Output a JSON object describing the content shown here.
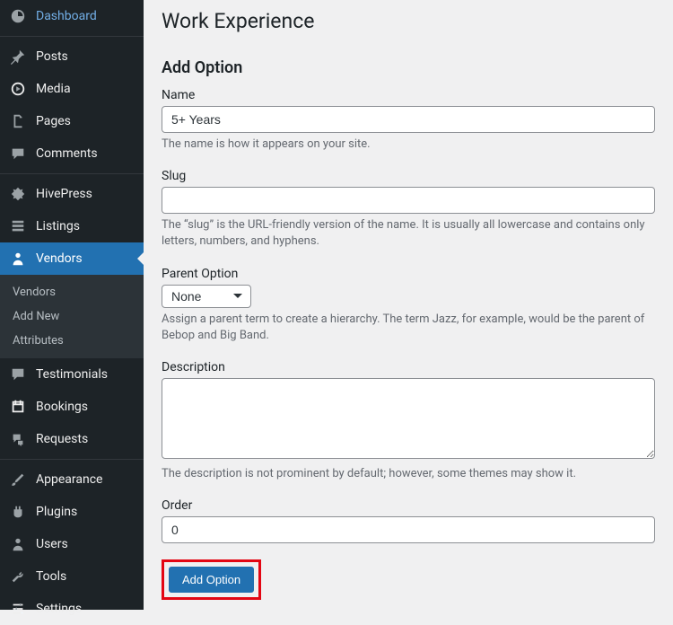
{
  "sidebar": {
    "items": [
      {
        "label": "Dashboard"
      },
      {
        "label": "Posts"
      },
      {
        "label": "Media"
      },
      {
        "label": "Pages"
      },
      {
        "label": "Comments"
      },
      {
        "label": "HivePress"
      },
      {
        "label": "Listings"
      },
      {
        "label": "Vendors"
      },
      {
        "label": "Testimonials"
      },
      {
        "label": "Bookings"
      },
      {
        "label": "Requests"
      },
      {
        "label": "Appearance"
      },
      {
        "label": "Plugins"
      },
      {
        "label": "Users"
      },
      {
        "label": "Tools"
      },
      {
        "label": "Settings"
      }
    ],
    "submenu": [
      {
        "label": "Vendors"
      },
      {
        "label": "Add New"
      },
      {
        "label": "Attributes"
      }
    ]
  },
  "page": {
    "title": "Work Experience",
    "section_title": "Add Option",
    "name": {
      "label": "Name",
      "value": "5+ Years",
      "hint": "The name is how it appears on your site."
    },
    "slug": {
      "label": "Slug",
      "value": "",
      "hint": "The “slug” is the URL-friendly version of the name. It is usually all lowercase and contains only letters, numbers, and hyphens."
    },
    "parent": {
      "label": "Parent Option",
      "selected": "None",
      "hint": "Assign a parent term to create a hierarchy. The term Jazz, for example, would be the parent of Bebop and Big Band."
    },
    "description": {
      "label": "Description",
      "value": "",
      "hint": "The description is not prominent by default; however, some themes may show it."
    },
    "order": {
      "label": "Order",
      "value": "0"
    },
    "submit_label": "Add Option"
  }
}
